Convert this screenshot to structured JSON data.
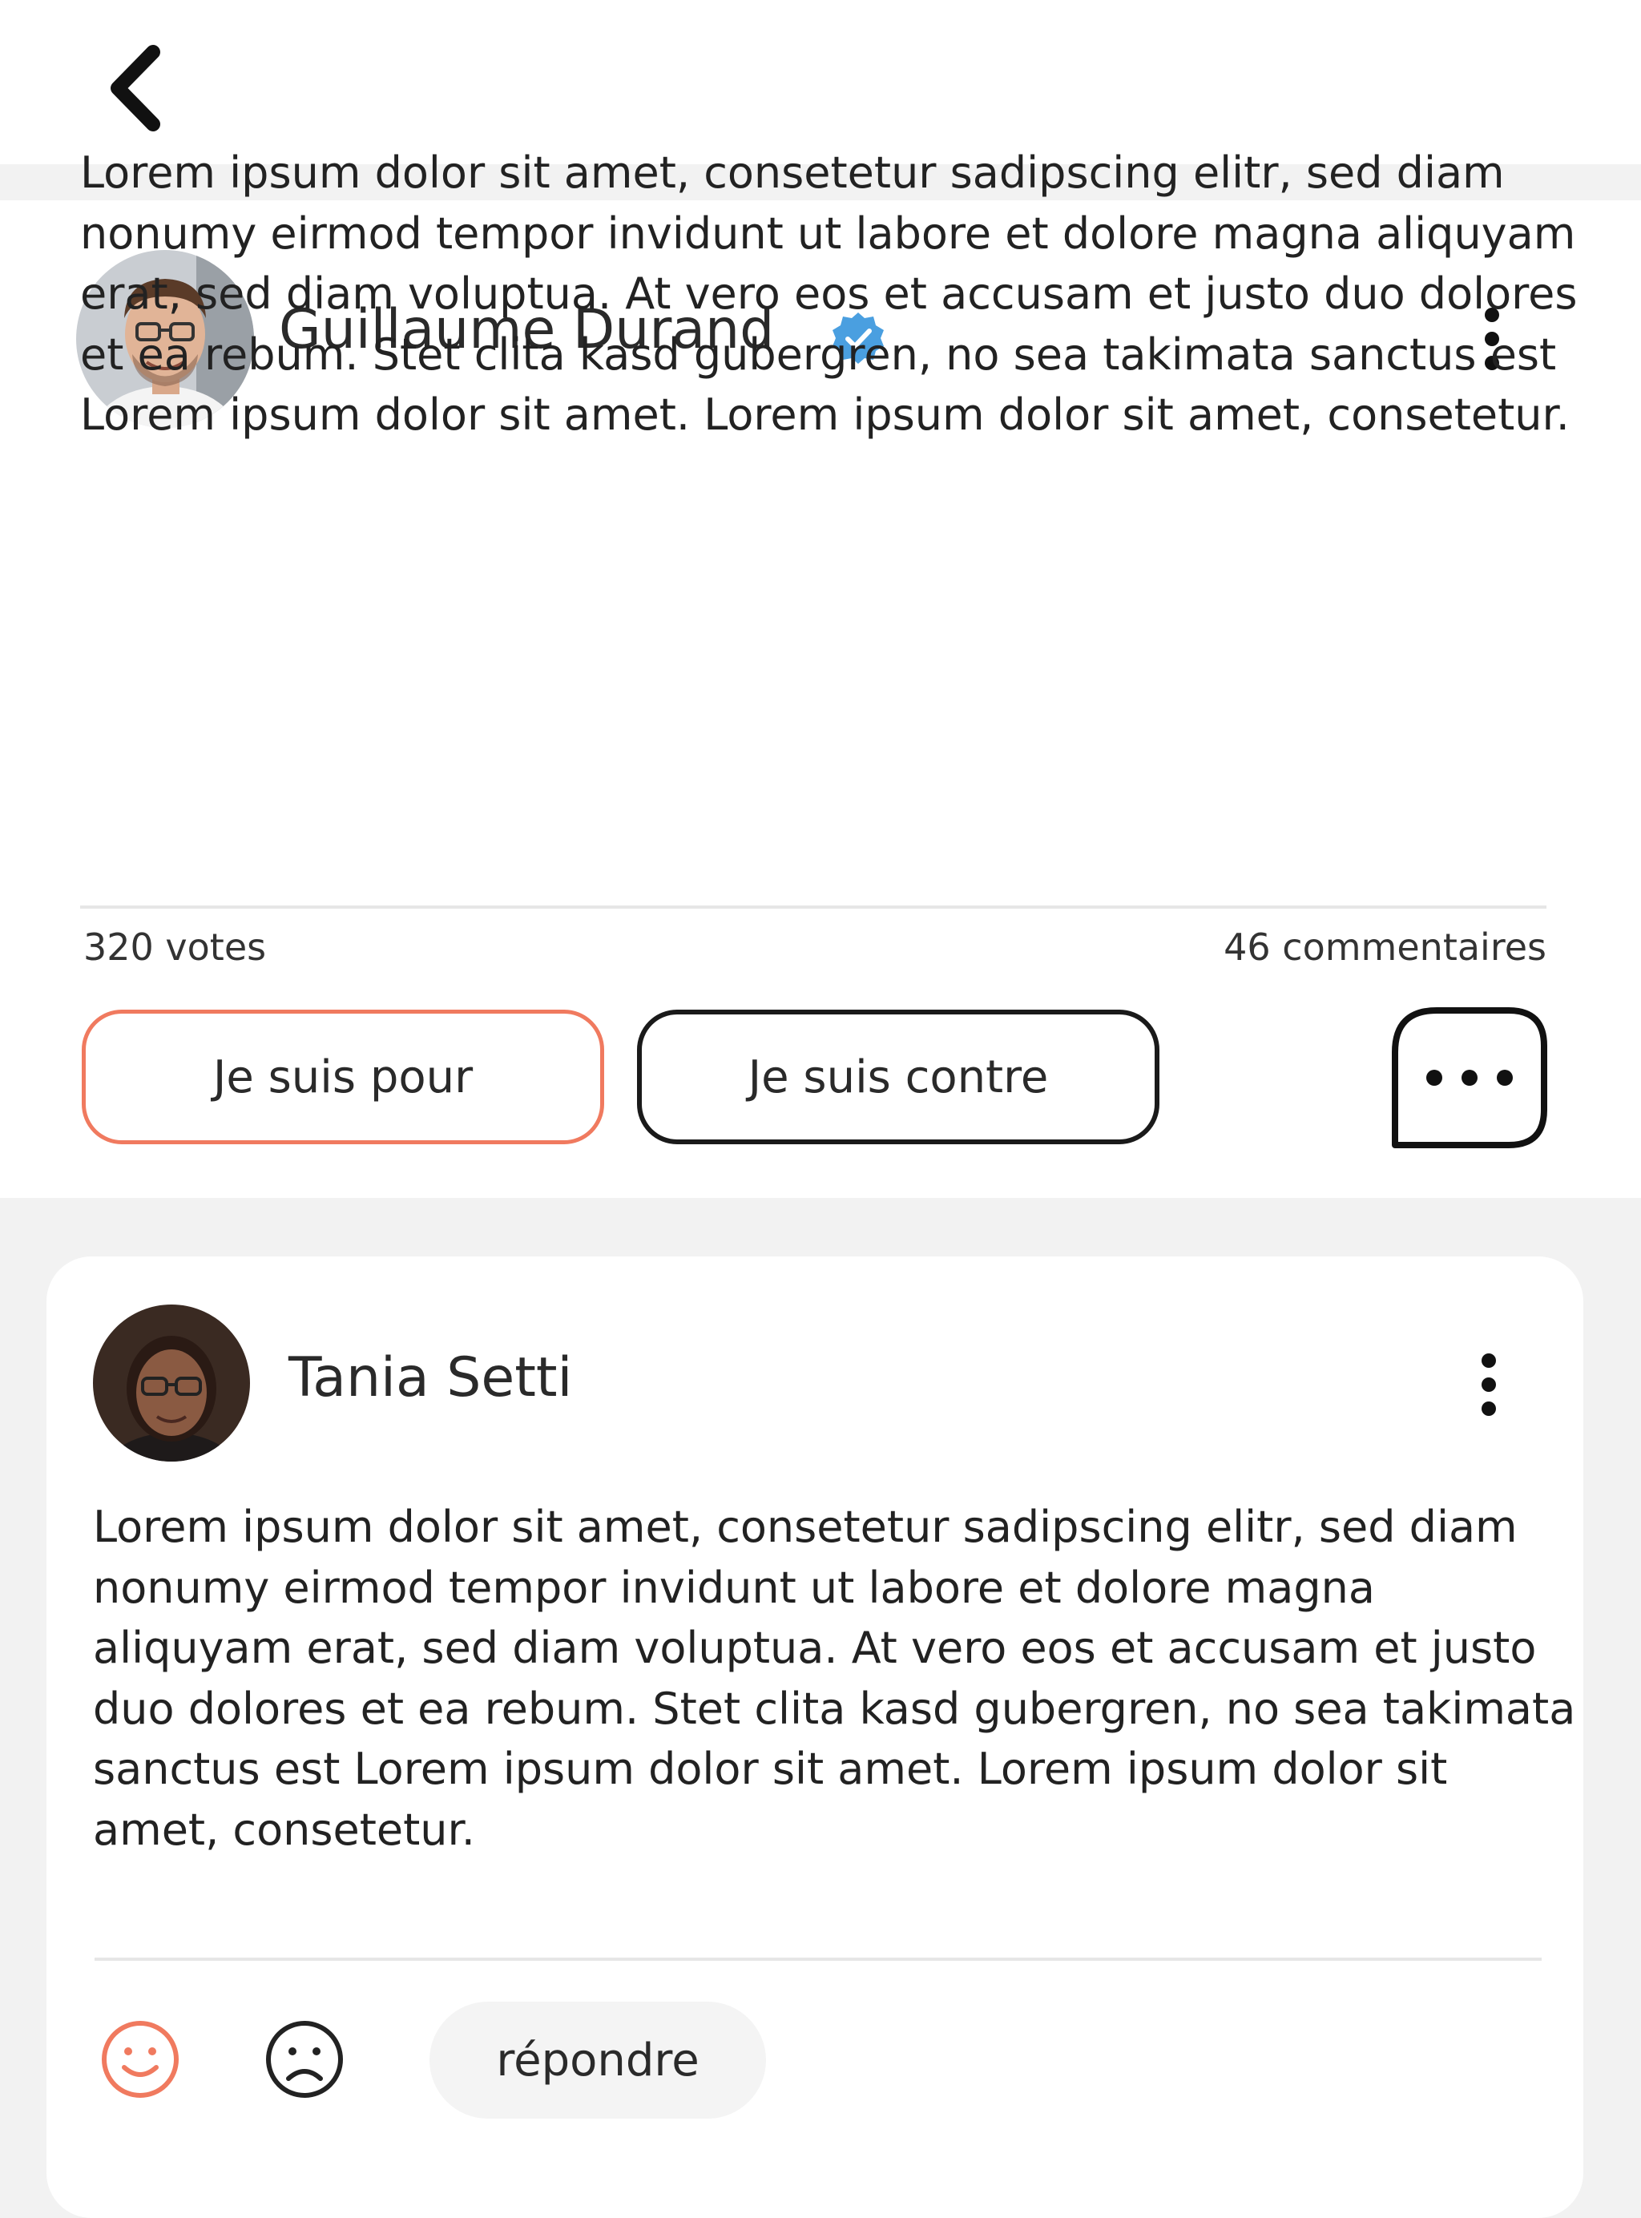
{
  "topbar": {
    "back_icon": "chevron-left-icon"
  },
  "post": {
    "author": "Guillaume Durand",
    "verified_icon": "verified-badge-icon",
    "verified_color": "#4a9fe0",
    "menu_icon": "more-vertical-icon",
    "body": "Lorem ipsum dolor sit amet, consetetur sadipscing elitr, sed diam nonumy eirmod tempor invidunt ut labore et dolore magna aliquyam erat, sed diam voluptua. At vero eos et accusam et justo duo dolores et ea rebum. Stet clita kasd gubergren, no sea takimata sanctus est Lorem ipsum dolor sit amet. Lorem ipsum dolor sit amet, consetetur.",
    "votes": "320 votes",
    "comments": "46 commentaires",
    "btn_for": "Je suis pour",
    "btn_against": "Je suis contre",
    "comment_icon": "comment-bubble-icon",
    "accent_color": "#f07a5f"
  },
  "comment": {
    "author": "Tania Setti",
    "menu_icon": "more-vertical-icon",
    "body": "Lorem ipsum dolor sit amet, consetetur sadipscing elitr, sed diam nonumy eirmod tempor invidunt ut labore et dolore magna aliquyam erat, sed diam voluptua. At vero eos et accusam et justo duo dolores et ea rebum. Stet clita kasd gubergren, no sea takimata sanctus est Lorem ipsum dolor sit amet. Lorem ipsum dolor sit amet, consetetur.",
    "happy_icon": "smile-icon",
    "sad_icon": "frown-icon",
    "reply": "répondre"
  }
}
